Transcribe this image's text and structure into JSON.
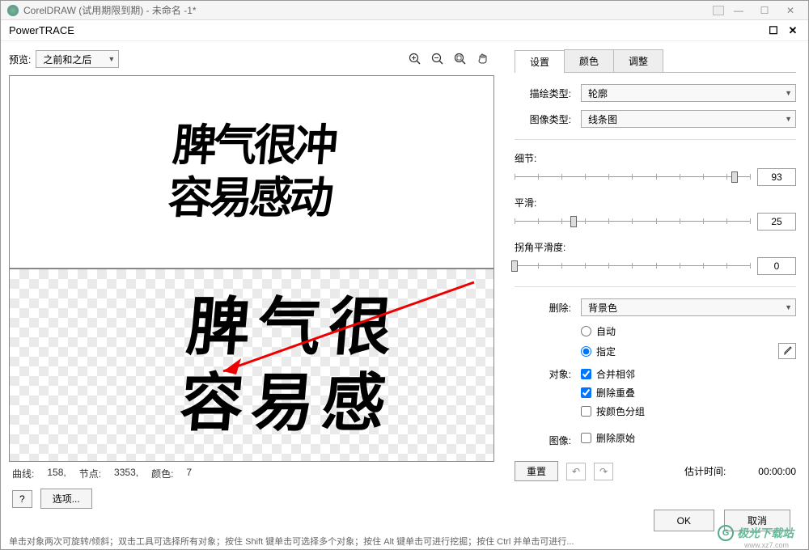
{
  "window": {
    "title": "CorelDRAW (试用期限到期) - 未命名 -1*"
  },
  "dialog": {
    "title": "PowerTRACE"
  },
  "preview": {
    "label": "预览:",
    "mode": "之前和之后",
    "sample_top_line1": "脾气很冲",
    "sample_top_line2": "容易感动",
    "sample_bot_line1": "脾 气 很",
    "sample_bot_line2": "容 易 感"
  },
  "tools": {
    "zoom_in": "zoom-in",
    "zoom_out": "zoom-out",
    "zoom_fit": "zoom-fit",
    "pan": "pan"
  },
  "stats": {
    "curves_label": "曲线:",
    "curves_value": "158,",
    "nodes_label": "节点:",
    "nodes_value": "3353,",
    "colors_label": "颜色:",
    "colors_value": "7"
  },
  "buttons": {
    "help": "?",
    "options": "选项...",
    "ok": "OK",
    "cancel": "取消",
    "reset": "重置"
  },
  "tabs": {
    "settings": "设置",
    "colors": "颜色",
    "adjust": "调整"
  },
  "settings": {
    "trace_type_label": "描绘类型:",
    "trace_type_value": "轮廓",
    "image_type_label": "图像类型:",
    "image_type_value": "线条图",
    "detail_label": "细节:",
    "detail_value": "93",
    "smooth_label": "平滑:",
    "smooth_value": "25",
    "corner_label": "拐角平滑度:",
    "corner_value": "0",
    "remove_label": "删除:",
    "remove_value": "背景色",
    "auto_label": "自动",
    "specify_label": "指定",
    "object_label": "对象:",
    "merge_adjacent": "合并相邻",
    "remove_overlap": "删除重叠",
    "group_by_color": "按颜色分组",
    "image_label": "图像:",
    "delete_original": "删除原始",
    "est_time_label": "估计时间:",
    "est_time_value": "00:00:00"
  },
  "footer": "单击对象两次可旋转/倾斜；双击工具可选择所有对象；按住 Shift 键单击可选择多个对象；按住 Alt 键单击可进行挖掘；按住 Ctrl 并单击可进行...",
  "watermark": {
    "text": "极光下载站",
    "sub": "www.xz7.com"
  }
}
